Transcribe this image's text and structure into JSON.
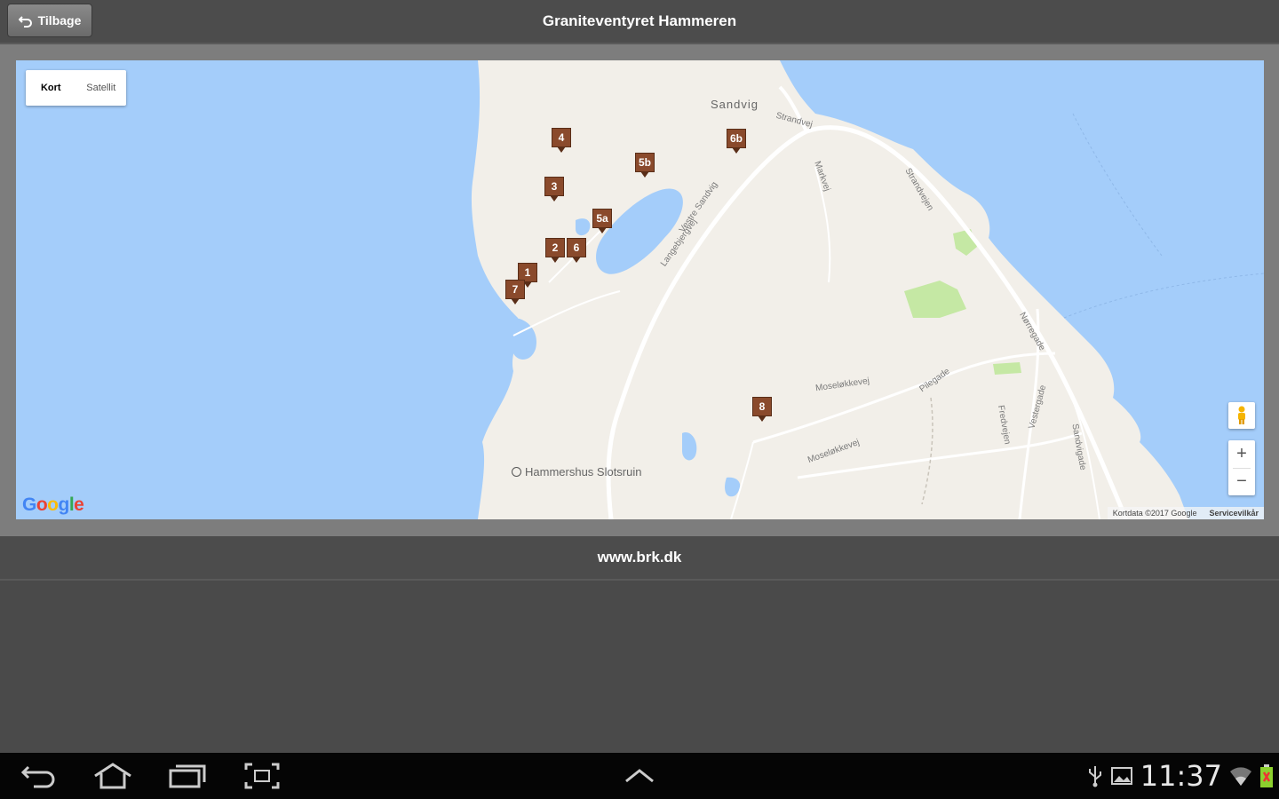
{
  "header": {
    "back_label": "Tilbage",
    "title": "Graniteventyret Hammeren"
  },
  "map": {
    "type_options": [
      "Kort",
      "Satellit"
    ],
    "active_type": "Kort",
    "place_labels": {
      "sandvig": "Sandvig",
      "hammershus": "Hammershus Slotsruin"
    },
    "road_labels": [
      "Strandvej",
      "Markvej",
      "Strandvejen",
      "Vestre Sandvig",
      "Langebjergvej",
      "Moseløkkevej",
      "Pilegade",
      "Moseløkkevej",
      "Fredvejen",
      "Vestergade",
      "Sandvigade",
      "Nørregade"
    ],
    "markers": [
      "4",
      "5b",
      "6b",
      "3",
      "5a",
      "2",
      "6",
      "1",
      "7",
      "8"
    ],
    "attribution": "Kortdata ©2017 Google",
    "terms": "Servicevilkår",
    "logo": "Google",
    "zoom_in": "+",
    "zoom_out": "−",
    "colors": {
      "water": "#a4cdfa",
      "land": "#f2efe9",
      "park": "#c5e8a4",
      "marker": "#8a4a2c"
    }
  },
  "footer": {
    "link": "www.brk.dk"
  },
  "system_bar": {
    "time": "11:37",
    "icons": [
      "back-icon",
      "home-icon",
      "recent-apps-icon",
      "screenshot-icon",
      "up-chevron-icon",
      "usb-icon",
      "gallery-icon",
      "wifi-icon",
      "battery-icon"
    ]
  }
}
